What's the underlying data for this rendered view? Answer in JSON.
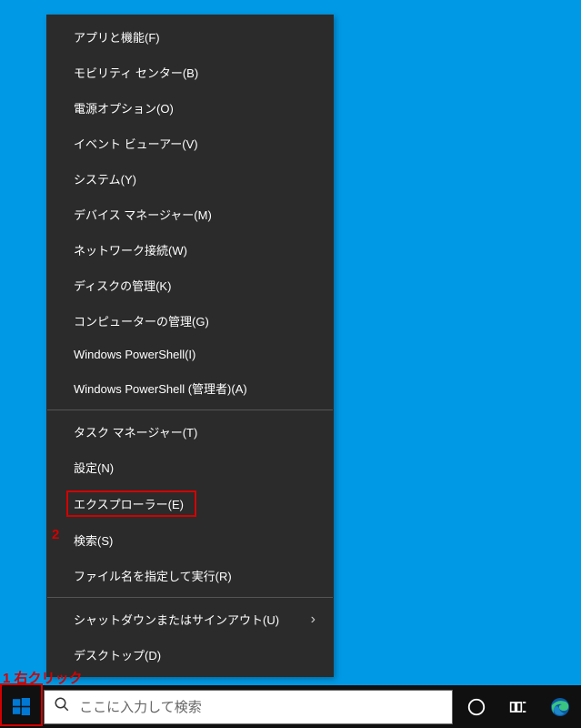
{
  "menu": {
    "items1": [
      "アプリと機能(F)",
      "モビリティ センター(B)",
      "電源オプション(O)",
      "イベント ビューアー(V)",
      "システム(Y)",
      "デバイス マネージャー(M)",
      "ネットワーク接続(W)",
      "ディスクの管理(K)",
      "コンピューターの管理(G)",
      "Windows PowerShell(I)",
      "Windows PowerShell (管理者)(A)"
    ],
    "items2_pre": [
      "タスク マネージャー(T)",
      "設定(N)"
    ],
    "highlighted": "エクスプローラー(E)",
    "items2_post": [
      "検索(S)",
      "ファイル名を指定して実行(R)"
    ],
    "items3": [
      {
        "label": "シャットダウンまたはサインアウト(U)",
        "submenu": true
      },
      {
        "label": "デスクトップ(D)",
        "submenu": false
      }
    ]
  },
  "annotations": {
    "label1": "1 右クリック",
    "label2": "2"
  },
  "taskbar": {
    "search_placeholder": "ここに入力して検索"
  }
}
